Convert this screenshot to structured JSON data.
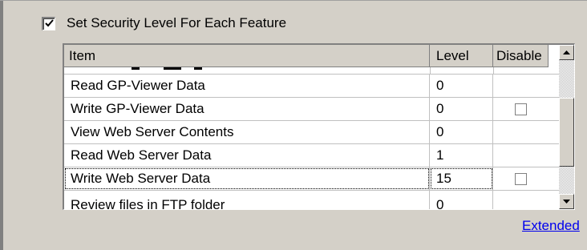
{
  "security_checkbox": {
    "label": "Set Security Level For Each Feature",
    "checked": true
  },
  "table": {
    "columns": {
      "item": "Item",
      "level": "Level",
      "disable": "Disable"
    },
    "rows": [
      {
        "item": "Read GP-Viewer Data",
        "level": "0",
        "disable_checkbox": false
      },
      {
        "item": "Write GP-Viewer Data",
        "level": "0",
        "disable_checkbox": true
      },
      {
        "item": "View Web Server Contents",
        "level": "0",
        "disable_checkbox": false
      },
      {
        "item": "Read Web Server Data",
        "level": "1",
        "disable_checkbox": false
      },
      {
        "item": "Write Web Server Data",
        "level": "15",
        "disable_checkbox": true
      },
      {
        "item": "Review files in FTP folder",
        "level": "0",
        "disable_checkbox": false
      }
    ]
  },
  "extended_link": "Extended"
}
